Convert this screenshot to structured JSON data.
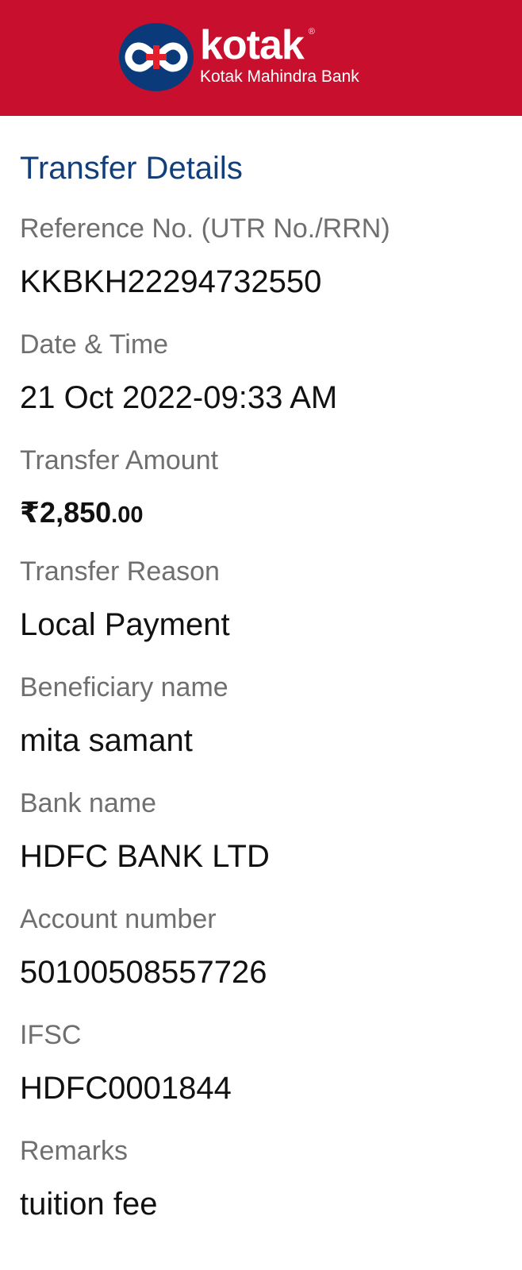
{
  "header": {
    "brand_name": "kotak",
    "registered_mark": "®",
    "bank_fullname": "Kotak Mahindra Bank",
    "background_color": "#c8102e",
    "logo_icon": "kotak-infinity-logo"
  },
  "section": {
    "title": "Transfer Details"
  },
  "fields": {
    "reference": {
      "label": "Reference No. (UTR No./RRN)",
      "value": "KKBKH22294732550"
    },
    "datetime": {
      "label": "Date & Time",
      "value": "21 Oct 2022-09:33 AM"
    },
    "amount": {
      "label": "Transfer Amount",
      "value_major": "₹2,850",
      "value_minor": ".00"
    },
    "reason": {
      "label": "Transfer Reason",
      "value": "Local Payment"
    },
    "beneficiary": {
      "label": "Beneficiary name",
      "value": "mita samant"
    },
    "bank": {
      "label": "Bank name",
      "value": "HDFC BANK LTD"
    },
    "account": {
      "label": "Account number",
      "value": "50100508557726"
    },
    "ifsc": {
      "label": "IFSC",
      "value": "HDFC0001844"
    },
    "remarks": {
      "label": "Remarks",
      "value": "tuition fee"
    }
  },
  "colors": {
    "title": "#123f7a",
    "label": "#6f6f6f",
    "value": "#111111"
  }
}
